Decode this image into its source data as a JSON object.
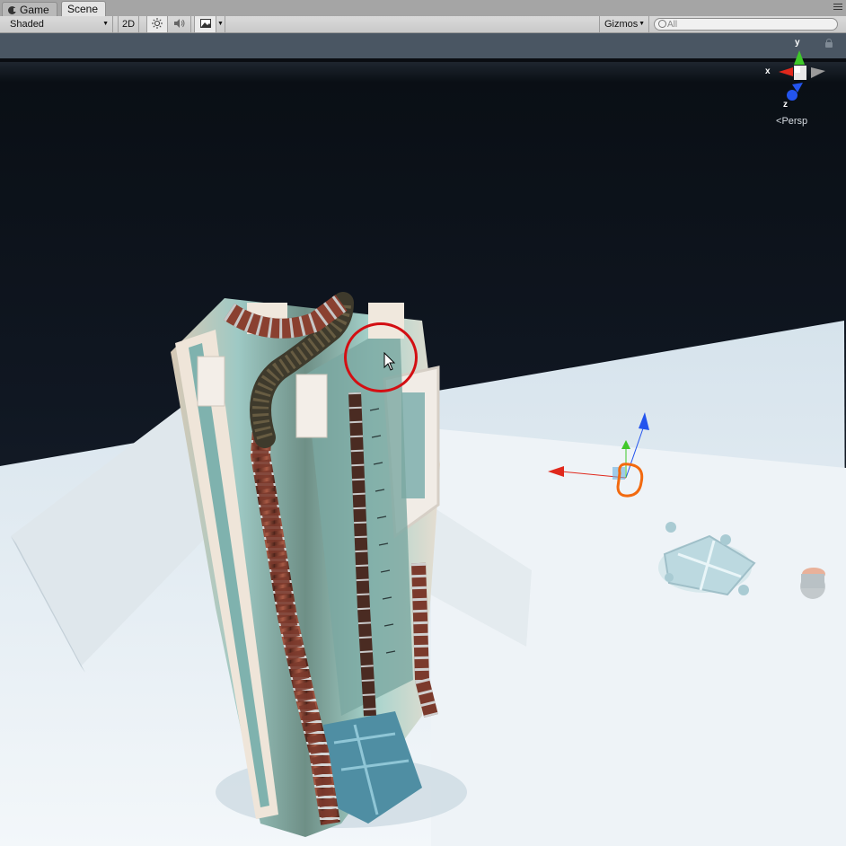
{
  "tabs": [
    {
      "label": "Game",
      "icon": "game-icon"
    },
    {
      "label": "Scene",
      "active": true
    }
  ],
  "toolbar": {
    "shading_mode": "Shaded",
    "mode_2d_label": "2D",
    "gizmos_label": "Gizmos",
    "search_placeholder": "All"
  },
  "scene_gizmo": {
    "x_label": "x",
    "y_label": "y",
    "z_label": "z",
    "projection_label": "Persp",
    "colors": {
      "x": "#e0281c",
      "y": "#3fc829",
      "z": "#2354ee"
    }
  }
}
